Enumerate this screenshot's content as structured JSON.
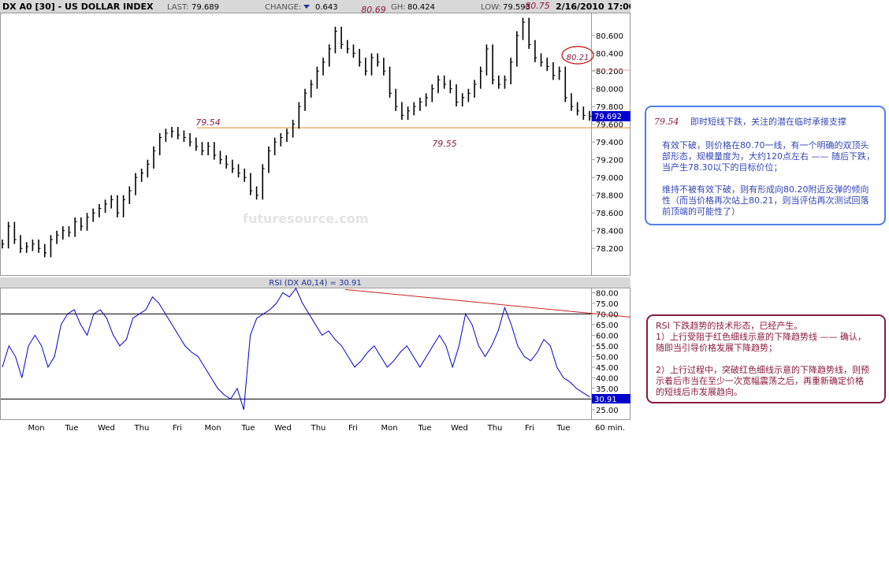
{
  "header": {
    "symbol": "DX A0 [30] - US DOLLAR INDEX",
    "last_label": "LAST:",
    "last_value": "79.689",
    "change_label": "CHANGE:",
    "change_value": "0.643",
    "high_label": "GH:",
    "high_value": "80.424",
    "low_label": "LOW:",
    "low_value": "79.593",
    "datetime": "2/16/2010 17:00"
  },
  "colors": {
    "price": "#000000",
    "rsi": "#0000cc",
    "support": "#e08a2c",
    "trend": "#cc2222",
    "note_blue": "#3346b5",
    "note_red": "#8b1a3e",
    "highlight": "#0000cc"
  },
  "chart_data": [
    {
      "type": "bar",
      "title": "DX A0 [30] - US DOLLAR INDEX",
      "ylim": [
        77.9,
        80.85
      ],
      "yticks": [
        "80.600",
        "80.400",
        "80.200",
        "80.000",
        "79.800",
        "79.600",
        "79.400",
        "79.200",
        "79.000",
        "78.800",
        "78.600",
        "78.400",
        "78.200"
      ],
      "current_price": "79.692",
      "x_day_labels": [
        "Mon",
        "Tue",
        "Wed",
        "Thu",
        "Fri",
        "Mon",
        "Tue",
        "Wed",
        "Thu",
        "Fri",
        "Mon",
        "Tue",
        "Wed",
        "Thu",
        "Fri",
        "Tue"
      ],
      "x_interval": "60 min.",
      "series": [
        {
          "values": [
            78.25,
            78.45,
            78.3,
            78.2,
            78.22,
            78.25,
            78.2,
            78.15,
            78.3,
            78.35,
            78.4,
            78.38,
            78.5,
            78.45,
            78.55,
            78.6,
            78.65,
            78.7,
            78.75,
            78.6,
            78.75,
            78.85,
            79.0,
            79.05,
            79.15,
            79.3,
            79.45,
            79.5,
            79.52,
            79.48,
            79.45,
            79.4,
            79.35,
            79.3,
            79.35,
            79.25,
            79.2,
            79.15,
            79.1,
            79.05,
            79.0,
            78.85,
            78.8,
            79.1,
            79.3,
            79.4,
            79.45,
            79.5,
            79.6,
            79.8,
            79.95,
            80.05,
            80.2,
            80.3,
            80.45,
            80.65,
            80.5,
            80.45,
            80.4,
            80.3,
            80.2,
            80.35,
            80.3,
            80.2,
            79.95,
            79.8,
            79.7,
            79.75,
            79.8,
            79.85,
            79.9,
            80.0,
            80.1,
            80.05,
            80.0,
            79.85,
            79.9,
            79.95,
            80.05,
            80.2,
            80.45,
            80.1,
            80.05,
            80.1,
            80.3,
            80.6,
            80.75,
            80.5,
            80.35,
            80.3,
            80.25,
            80.15,
            80.2,
            79.9,
            79.8,
            79.75,
            79.7,
            79.69
          ]
        }
      ],
      "annotations": [
        {
          "label": "80.69"
        },
        {
          "label": "80.75"
        },
        {
          "label": "80.21"
        },
        {
          "label": "79.54"
        },
        {
          "label": "79.55"
        }
      ],
      "support_level": 79.56,
      "watermark": "futuresource.com"
    },
    {
      "type": "line",
      "title": "RSI (DX A0,14) = 30.91",
      "ylim": [
        20.5,
        82
      ],
      "yticks": [
        "80.00",
        "75.00",
        "70.00",
        "65.00",
        "60.00",
        "55.00",
        "50.00",
        "45.00",
        "40.00",
        "35.00",
        "30.00",
        "25.00"
      ],
      "overbought": 70,
      "oversold": 30,
      "current_value": "30.91",
      "series": [
        {
          "values": [
            45,
            55,
            50,
            40,
            55,
            60,
            55,
            45,
            50,
            65,
            70,
            72,
            65,
            60,
            70,
            72,
            68,
            60,
            55,
            58,
            68,
            70,
            72,
            78,
            75,
            70,
            65,
            60,
            55,
            52,
            50,
            45,
            40,
            35,
            32,
            30,
            35,
            25,
            60,
            68,
            70,
            72,
            75,
            80,
            78,
            82,
            75,
            70,
            65,
            60,
            62,
            58,
            55,
            50,
            45,
            48,
            52,
            55,
            50,
            45,
            48,
            52,
            55,
            50,
            45,
            50,
            55,
            60,
            55,
            45,
            55,
            70,
            65,
            55,
            50,
            55,
            62,
            73,
            65,
            55,
            50,
            48,
            52,
            58,
            55,
            45,
            40,
            38,
            35,
            33,
            31
          ]
        }
      ],
      "trendline_label": ""
    }
  ],
  "notes": {
    "top": {
      "price": "79.54",
      "headline": "即时短线下跌，关注的潜在临时承接支撑",
      "para1": [
        "有效下破，则价格在80.70一线，有一个明确的双顶头",
        "部形态，规模量度为，大约120点左右 —— 随后下跌，",
        "当产生78.30以下的目标价位；"
      ],
      "para2": [
        "维持不被有效下破，则有形成向80.20附近反弹的倾向",
        "性（而当价格再次站上80.21，则当评估再次测试回落",
        "前顶端的可能性了）"
      ]
    },
    "bottom": {
      "lines": [
        "RSI 下跌趋势的技术形态，已经产生。",
        "1）上行受阻于红色细线示意的下降趋势线 —— 确认，",
        "随即当引导价格发展下降趋势；",
        "",
        "2）上行过程中，突破红色细线示意的下降趋势线，则预",
        "示着后市当在至少一次宽幅震荡之后，再重新确定价格",
        "的短线后市发展趋向。"
      ]
    }
  }
}
